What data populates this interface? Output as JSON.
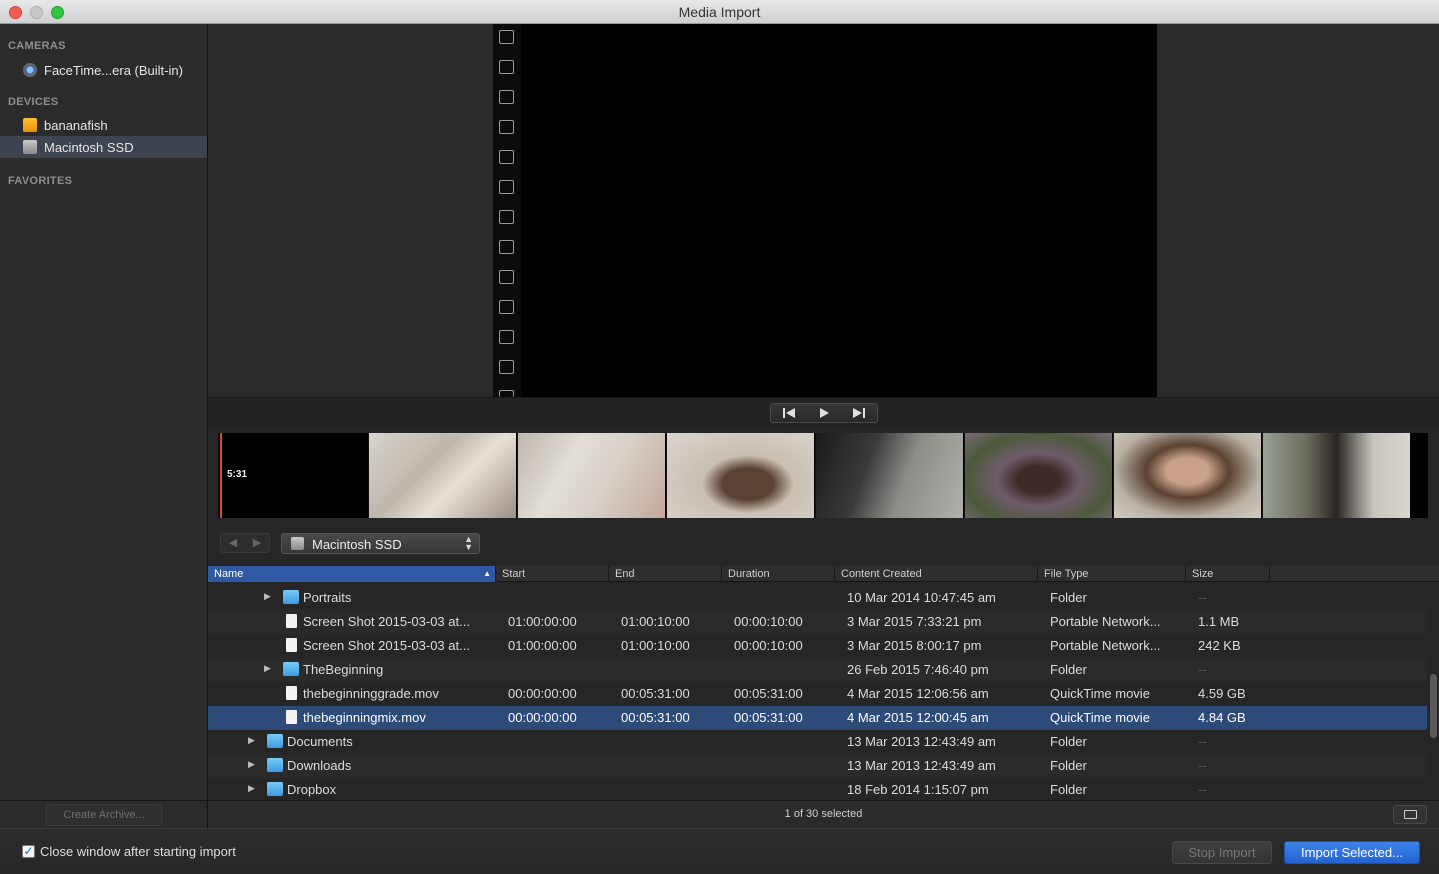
{
  "window": {
    "title": "Media Import"
  },
  "sidebar": {
    "sections": [
      {
        "heading": "CAMERAS",
        "items": [
          {
            "label": "FaceTime...era (Built-in)",
            "icon": "camera-icon"
          }
        ]
      },
      {
        "heading": "DEVICES",
        "items": [
          {
            "label": "bananafish",
            "icon": "external-drive-icon"
          },
          {
            "label": "Macintosh SSD",
            "icon": "internal-drive-icon",
            "selected": true
          }
        ]
      },
      {
        "heading": "FAVORITES",
        "items": []
      }
    ]
  },
  "thumbnails": {
    "timecode": "5:31"
  },
  "browser": {
    "location": "Macintosh SSD",
    "columns": [
      "Name",
      "Start",
      "End",
      "Duration",
      "Content Created",
      "File Type",
      "Size"
    ],
    "rows": [
      {
        "name": "Portraits",
        "kind": "folder",
        "indent": 2,
        "start": "",
        "end": "",
        "duration": "",
        "created": "10 Mar 2014 10:47:45 am",
        "type": "Folder",
        "size": "--"
      },
      {
        "name": "Screen Shot 2015-03-03 at...",
        "kind": "doc",
        "indent": 2,
        "start": "01:00:00:00",
        "end": "01:00:10:00",
        "duration": "00:00:10:00",
        "created": "3 Mar 2015 7:33:21 pm",
        "type": "Portable Network...",
        "size": "1.1 MB"
      },
      {
        "name": "Screen Shot 2015-03-03 at...",
        "kind": "doc",
        "indent": 2,
        "start": "01:00:00:00",
        "end": "01:00:10:00",
        "duration": "00:00:10:00",
        "created": "3 Mar 2015 8:00:17 pm",
        "type": "Portable Network...",
        "size": "242 KB"
      },
      {
        "name": "TheBeginning",
        "kind": "folder",
        "indent": 2,
        "start": "",
        "end": "",
        "duration": "",
        "created": "26 Feb 2015 7:46:40 pm",
        "type": "Folder",
        "size": "--"
      },
      {
        "name": "thebeginninggrade.mov",
        "kind": "doc",
        "indent": 2,
        "start": "00:00:00:00",
        "end": "00:05:31:00",
        "duration": "00:05:31:00",
        "created": "4 Mar 2015 12:06:56 am",
        "type": "QuickTime movie",
        "size": "4.59 GB"
      },
      {
        "name": "thebeginningmix.mov",
        "kind": "doc",
        "indent": 2,
        "selected": true,
        "start": "00:00:00:00",
        "end": "00:05:31:00",
        "duration": "00:05:31:00",
        "created": "4 Mar 2015 12:00:45 am",
        "type": "QuickTime movie",
        "size": "4.84 GB"
      },
      {
        "name": "Documents",
        "kind": "folder",
        "indent": 1,
        "start": "",
        "end": "",
        "duration": "",
        "created": "13 Mar 2013 12:43:49 am",
        "type": "Folder",
        "size": "--"
      },
      {
        "name": "Downloads",
        "kind": "folder",
        "indent": 1,
        "start": "",
        "end": "",
        "duration": "",
        "created": "13 Mar 2013 12:43:49 am",
        "type": "Folder",
        "size": "--"
      },
      {
        "name": "Dropbox",
        "kind": "folder",
        "indent": 1,
        "start": "",
        "end": "",
        "duration": "",
        "created": "18 Feb 2014 1:15:07 pm",
        "type": "Folder",
        "size": "--"
      }
    ]
  },
  "status": {
    "selection": "1 of 30 selected",
    "create_archive": "Create Archive..."
  },
  "footer": {
    "close_after_import": "Close window after starting import",
    "close_after_import_checked": true,
    "stop_import": "Stop Import",
    "import_selected": "Import Selected..."
  },
  "colors": {
    "accent": "#2e4a78",
    "primary_button": "#2f6fde"
  }
}
